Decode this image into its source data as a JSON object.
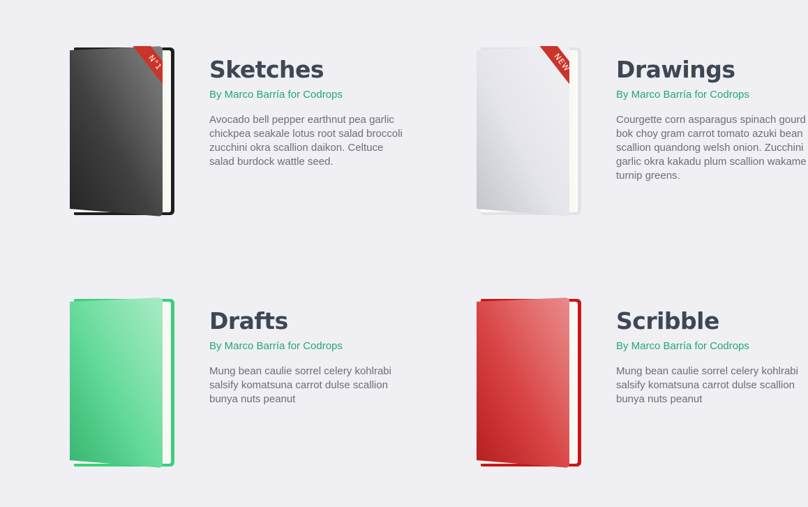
{
  "books": [
    {
      "title": "Sketches",
      "author": "By Marco Barría for Codrops",
      "description": "Avocado bell pepper earthnut pea garlic chickpea seakale lotus root salad broccoli zucchini okra scallion daikon. Celtuce salad burdock wattle seed.",
      "ribbon": "N°1",
      "cover_color": "#3c3c3c",
      "cover_gradient": [
        "#5e5e5e",
        "#2a2a2a"
      ],
      "back_color": "#1f1f1f",
      "ribbon_color": "#c9342b"
    },
    {
      "title": "Drawings",
      "author": "By Marco Barría for Codrops",
      "description": "Courgette corn asparagus spinach gourd bok choy gram carrot tomato azuki bean scallion quandong welsh onion. Zucchini garlic okra kakadu plum scallion wakame turnip greens.",
      "ribbon": "NEW",
      "cover_color": "#e8e8ee",
      "cover_gradient": [
        "#ececf1",
        "#dedee6"
      ],
      "back_color": "#e2e2e8",
      "ribbon_color": "#c9342b"
    },
    {
      "title": "Drafts",
      "author": "By Marco Barría for Codrops",
      "description": "Mung bean caulie sorrel celery kohlrabi salsify komatsuna carrot dulse scallion bunya nuts peanut",
      "ribbon": "",
      "cover_color": "#55d691",
      "cover_gradient": [
        "#8ee6b4",
        "#3fcf80"
      ],
      "back_color": "#3ccf7d",
      "ribbon_color": ""
    },
    {
      "title": "Scribble",
      "author": "By Marco Barría for Codrops",
      "description": "Mung bean caulie sorrel celery kohlrabi salsify komatsuna carrot dulse scallion bunya nuts peanut",
      "ribbon": "",
      "cover_color": "#d93a3a",
      "cover_gradient": [
        "#e46a6a",
        "#cf2323"
      ],
      "back_color": "#c81818",
      "ribbon_color": ""
    }
  ]
}
